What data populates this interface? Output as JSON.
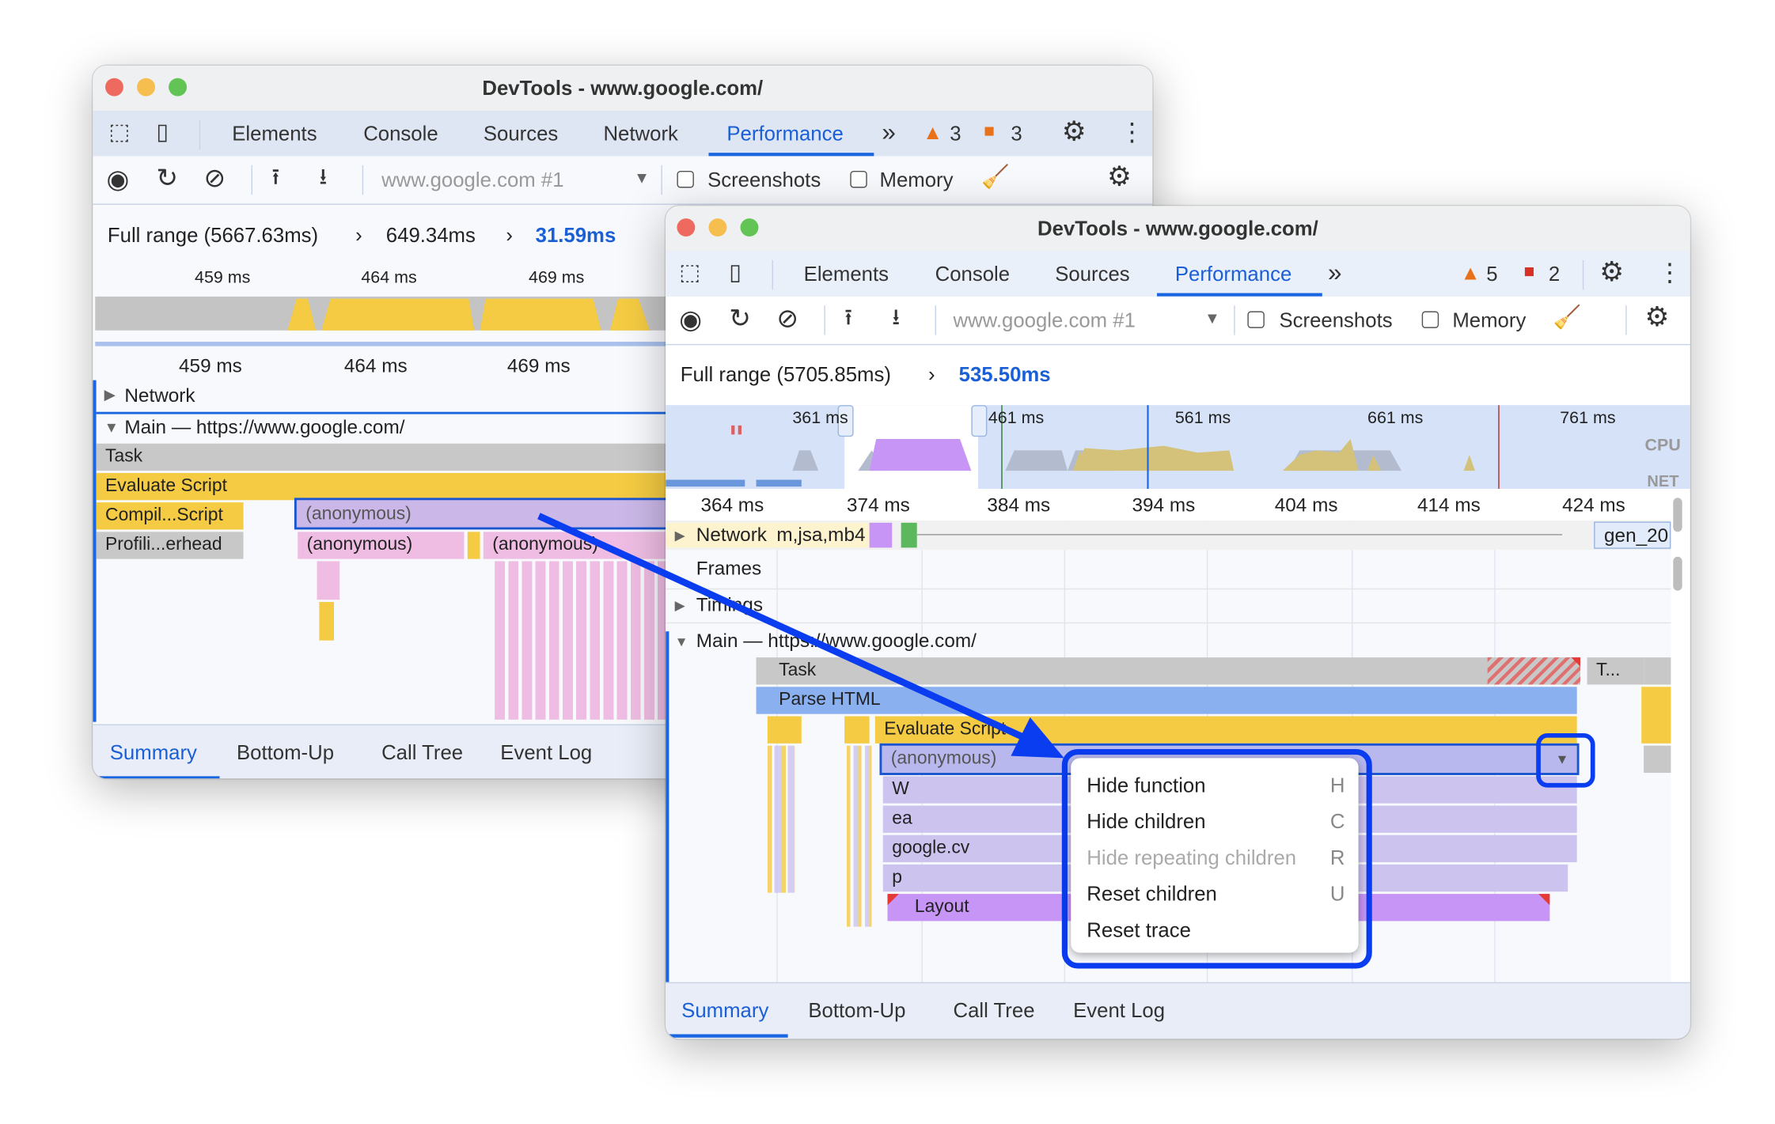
{
  "back_window": {
    "title": "DevTools - www.google.com/",
    "tabs": [
      "Elements",
      "Console",
      "Sources",
      "Network",
      "Performance"
    ],
    "active_tab": "Performance",
    "more_tabs": "»",
    "warnings": "3",
    "errors": "3",
    "recording_select": "www.google.com #1",
    "screenshots_label": "Screenshots",
    "memory_label": "Memory",
    "breadcrumb": [
      "Full range (5667.63ms)",
      "649.34ms",
      "31.59ms"
    ],
    "overview_ticks": [
      "459 ms",
      "464 ms",
      "469 ms"
    ],
    "ruler_ticks": [
      "459 ms",
      "464 ms",
      "469 ms"
    ],
    "tracks": {
      "network": "Network",
      "main": "Main — https://www.google.com/"
    },
    "flame": {
      "task": "Task",
      "evaluate": "Evaluate Script",
      "compile": "Compil...Script",
      "profiling": "Profili...erhead",
      "anon1": "(anonymous)",
      "anon2": "(anonymous)",
      "anon3": "(anonymous)"
    },
    "bottom_tabs": [
      "Summary",
      "Bottom-Up",
      "Call Tree",
      "Event Log"
    ]
  },
  "front_window": {
    "title": "DevTools - www.google.com/",
    "tabs": [
      "Elements",
      "Console",
      "Sources",
      "Performance"
    ],
    "active_tab": "Performance",
    "more_tabs": "»",
    "warnings": "5",
    "errors": "2",
    "recording_select": "www.google.com #1",
    "screenshots_label": "Screenshots",
    "memory_label": "Memory",
    "breadcrumb": [
      "Full range (5705.85ms)",
      "535.50ms"
    ],
    "overview_ticks": [
      "361 ms",
      "461 ms",
      "561 ms",
      "661 ms",
      "761 ms"
    ],
    "overview_labels": {
      "cpu": "CPU",
      "net": "NET"
    },
    "ruler_ticks": [
      "364 ms",
      "374 ms",
      "384 ms",
      "394 ms",
      "404 ms",
      "414 ms",
      "424 ms"
    ],
    "tracks": {
      "network": "Network",
      "network_items": "m,jsa,mb4",
      "network_end": "gen_20",
      "frames": "Frames",
      "timings": "Timings",
      "main": "Main — https://www.google.com/"
    },
    "flame": {
      "task": "Task",
      "task2": "T...",
      "parse": "Parse HTML",
      "evaluate": "Evaluate Script",
      "anon": "(anonymous)",
      "w": "W",
      "ea": "ea",
      "cv": "google.cv",
      "p": "p",
      "layout": "Layout"
    },
    "context_menu": [
      {
        "label": "Hide function",
        "key": "H",
        "disabled": false
      },
      {
        "label": "Hide children",
        "key": "C",
        "disabled": false
      },
      {
        "label": "Hide repeating children",
        "key": "R",
        "disabled": true
      },
      {
        "label": "Reset children",
        "key": "U",
        "disabled": false
      },
      {
        "label": "Reset trace",
        "key": "",
        "disabled": false
      }
    ],
    "bottom_tabs": [
      "Summary",
      "Bottom-Up",
      "Call Tree",
      "Event Log"
    ]
  },
  "colors": {
    "accent": "#1a66e0",
    "highlight": "#0a3cf0",
    "task": "#c8c8c8",
    "evaluate": "#f4cb42",
    "parse": "#8ab0f0",
    "function": "#cdc3ef",
    "layout": "#c795f5"
  }
}
